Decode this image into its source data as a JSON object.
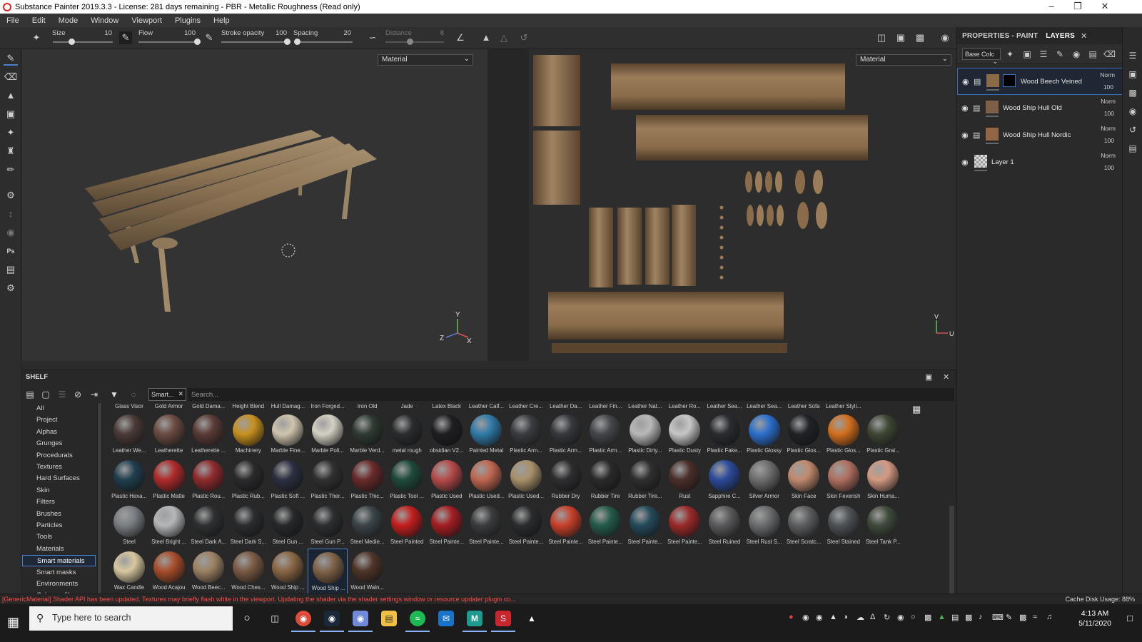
{
  "window": {
    "title": "Substance Painter 2019.3.3 - License: 281 days remaining - PBR - Metallic Roughness (Read only)"
  },
  "menu": [
    "File",
    "Edit",
    "Mode",
    "Window",
    "Viewport",
    "Plugins",
    "Help"
  ],
  "toolbar": {
    "size_label": "Size",
    "size_value": "10",
    "flow_label": "Flow",
    "flow_value": "100",
    "stroke_label": "Stroke opacity",
    "stroke_value": "100",
    "spacing_label": "Spacing",
    "spacing_value": "20",
    "distance_label": "Distance",
    "distance_value": "8"
  },
  "viewport3d": {
    "mode": "Material",
    "axes": {
      "x": "X",
      "y": "Y",
      "z": "Z"
    }
  },
  "viewport2d": {
    "mode": "Material",
    "axes": {
      "v": "V",
      "u": "U"
    }
  },
  "panel": {
    "tab_properties": "PROPERTIES - PAINT",
    "tab_layers": "LAYERS",
    "blend_mode": "Base Colc",
    "layers": [
      {
        "name": "Wood Beech Veined",
        "blend": "Norm",
        "opacity": "100",
        "thumb": "#8a6a47"
      },
      {
        "name": "Wood Ship Hull Old",
        "blend": "Norm",
        "opacity": "100",
        "thumb": "#7d5f43"
      },
      {
        "name": "Wood Ship Hull Nordic",
        "blend": "Norm",
        "opacity": "100",
        "thumb": "#936445"
      },
      {
        "name": "Layer 1",
        "blend": "Norm",
        "opacity": "100",
        "thumb": "#cccccc"
      }
    ]
  },
  "shelf": {
    "title": "SHELF",
    "filter_chip": "Smart...",
    "search_placeholder": "Search...",
    "categories": [
      "All",
      "Project",
      "Alphas",
      "Grunges",
      "Procedurals",
      "Textures",
      "Hard Surfaces",
      "Skin",
      "Filters",
      "Brushes",
      "Particles",
      "Tools",
      "Materials",
      "Smart materials",
      "Smart masks",
      "Environments",
      "Color profiles"
    ],
    "selected_category": "Smart materials",
    "top_labels": [
      "Glass Visor",
      "Gold Armor",
      "Gold Dama...",
      "Height Blend",
      "Hull Damag...",
      "Iron Forged...",
      "Iron Old",
      "Jade",
      "Latex Black",
      "Leather Calf...",
      "Leather Cre...",
      "Leather Da...",
      "Leather Fin...",
      "Leather Nat...",
      "Leather Ro...",
      "Leather Sea...",
      "Leather Sea...",
      "Leather Sofa",
      "Leather Styli..."
    ],
    "rows": [
      [
        {
          "n": "Leather We...",
          "c": "#4a3a36"
        },
        {
          "n": "Leatherette",
          "c": "#6b4a42"
        },
        {
          "n": "Leatherette ...",
          "c": "#5a3a36"
        },
        {
          "n": "Machinery",
          "c": "#c8901e"
        },
        {
          "n": "Marble Fine...",
          "c": "#cfc4ae"
        },
        {
          "n": "Marble Poli...",
          "c": "#d4d0c4"
        },
        {
          "n": "Marble Verd...",
          "c": "#2e3a32"
        },
        {
          "n": "metal rough",
          "c": "#2a2c2e"
        },
        {
          "n": "obsidian V2...",
          "c": "#1e1e22"
        },
        {
          "n": "Painted Metal",
          "c": "#2f7aa8"
        },
        {
          "n": "Plastic Arm...",
          "c": "#3a3c40"
        },
        {
          "n": "Plastic Arm...",
          "c": "#36383c"
        },
        {
          "n": "Plastic Arm...",
          "c": "#44464a"
        },
        {
          "n": "Plastic Dirty...",
          "c": "#b8b8b8"
        },
        {
          "n": "Plastic Dusty",
          "c": "#c6c6c6"
        },
        {
          "n": "Plastic Fake...",
          "c": "#2a2c30"
        },
        {
          "n": "Plastic Glossy",
          "c": "#2b6fcc"
        },
        {
          "n": "Plastic Glos...",
          "c": "#202226"
        },
        {
          "n": "Plastic Glos...",
          "c": "#d36f1e"
        },
        {
          "n": "Plastic Grai...",
          "c": "#3e4634"
        }
      ],
      [
        {
          "n": "Plastic Hexa...",
          "c": "#1f3e4e"
        },
        {
          "n": "Plastic Matte",
          "c": "#b02a2a"
        },
        {
          "n": "Plastic Rou...",
          "c": "#8f2a2c"
        },
        {
          "n": "Plastic Rub...",
          "c": "#2a2a2c"
        },
        {
          "n": "Plastic Soft ...",
          "c": "#2b2f40"
        },
        {
          "n": "Plastic Ther...",
          "c": "#303030"
        },
        {
          "n": "Plastic Thic...",
          "c": "#6a2a2a"
        },
        {
          "n": "Plastic Tool ...",
          "c": "#1e4a3a"
        },
        {
          "n": "Plastic Used",
          "c": "#b64a4a"
        },
        {
          "n": "Plastic Used...",
          "c": "#c06650"
        },
        {
          "n": "Plastic Used...",
          "c": "#a8906a"
        },
        {
          "n": "Rubber Dry",
          "c": "#2e2e30"
        },
        {
          "n": "Rubber Tire",
          "c": "#2a2a2a"
        },
        {
          "n": "Rubber Tire...",
          "c": "#2f2f2f"
        },
        {
          "n": "Rust",
          "c": "#4a2e2a"
        },
        {
          "n": "Sapphire C...",
          "c": "#2a4a9a"
        },
        {
          "n": "Silver Armor",
          "c": "#6e6e6e"
        },
        {
          "n": "Skin Face",
          "c": "#c08a6e"
        },
        {
          "n": "Skin Feverish",
          "c": "#b07060"
        },
        {
          "n": "Skin Huma...",
          "c": "#d49a82"
        }
      ],
      [
        {
          "n": "Steel",
          "c": "#7a7e82"
        },
        {
          "n": "Steel Bright ...",
          "c": "#b4b6b8"
        },
        {
          "n": "Steel Dark A...",
          "c": "#2e3032"
        },
        {
          "n": "Steel Dark S...",
          "c": "#2a2c2e"
        },
        {
          "n": "Steel Gun ...",
          "c": "#26282a"
        },
        {
          "n": "Steel Gun P...",
          "c": "#2c2e30"
        },
        {
          "n": "Steel Medie...",
          "c": "#3a4448"
        },
        {
          "n": "Steel Painted",
          "c": "#c41e1e"
        },
        {
          "n": "Steel Painte...",
          "c": "#a41e22"
        },
        {
          "n": "Steel Painte...",
          "c": "#3a3c3e"
        },
        {
          "n": "Steel Painte...",
          "c": "#2a2c2e"
        },
        {
          "n": "Steel Painte...",
          "c": "#c8402a"
        },
        {
          "n": "Steel Painte...",
          "c": "#245a4a"
        },
        {
          "n": "Steel Painte...",
          "c": "#244a5a"
        },
        {
          "n": "Steel Painte...",
          "c": "#9a2a2a"
        },
        {
          "n": "Steel Ruined",
          "c": "#5a5a5c"
        },
        {
          "n": "Steel Rust S...",
          "c": "#6a6c6e"
        },
        {
          "n": "Steel Scratc...",
          "c": "#5c5e60"
        },
        {
          "n": "Steel Stained",
          "c": "#4e5256"
        },
        {
          "n": "Steel Tank P...",
          "c": "#3e4a3a"
        }
      ],
      [
        {
          "n": "Wax Candle",
          "c": "#d8c8a0"
        },
        {
          "n": "Wood Acajou",
          "c": "#a84e2a"
        },
        {
          "n": "Wood Beec...",
          "c": "#9c8264"
        },
        {
          "n": "Wood Ches...",
          "c": "#7a5a44"
        },
        {
          "n": "Wood Ship ...",
          "c": "#8a6644"
        },
        {
          "n": "Wood Ship ...",
          "c": "#7e6248"
        },
        {
          "n": "Wood Waln...",
          "c": "#4e3428"
        }
      ]
    ],
    "selected_cell_index": 5
  },
  "status": {
    "message": "[GenericMaterial] Shader API has been updated. Textures may briefly flash white in the viewport. Updating the shader via the shader settings window or resource updater plugin co...",
    "cache": "Cache Disk Usage:   88%"
  },
  "taskbar": {
    "search_placeholder": "Type here to search",
    "time": "4:13 AM",
    "date": "5/11/2020"
  }
}
